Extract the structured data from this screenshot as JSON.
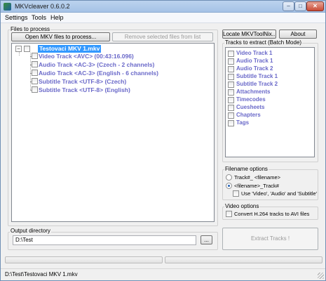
{
  "window": {
    "title": "MKVcleaver 0.6.0.2"
  },
  "titlebar": {
    "minimize": "–",
    "maximize": "□",
    "close": "✕"
  },
  "menu": [
    "Settings",
    "Tools",
    "Help"
  ],
  "files_group": {
    "label": "Files to process",
    "open_button": "Open MKV files to process...",
    "remove_button": "Remove selected files from list",
    "tree": {
      "root": "Testovaci MKV 1.mkv",
      "expander": "−",
      "tracks": [
        "Video Track <AVC> (00:43:16.096)",
        "Audio Track <AC-3> (Czech - 2 channels)",
        "Audio Track <AC-3> (English - 6 channels)",
        "Subtitle Track <UTF-8> (Czech)",
        "Subtitle Track <UTF-8> (English)"
      ]
    }
  },
  "top_right": {
    "locate_button": "Locate MKVToolNix...",
    "about_button": "About"
  },
  "batch_group": {
    "label": "Tracks to extract (Batch Mode)",
    "items": [
      "Video Track 1",
      "Audio Track 1",
      "Audio Track 2",
      "Subtitle Track 1",
      "Subtitle Track 2",
      "Attachments",
      "Timecodes",
      "Cuesheets",
      "Chapters",
      "Tags"
    ]
  },
  "filename_group": {
    "label": "Filename options",
    "option1": "Track#_ <filename>",
    "option2": "<filename>_Track#",
    "checkbox": "Use 'Video', 'Audio' and 'Subtitle'"
  },
  "video_group": {
    "label": "Video options",
    "checkbox": "Convert H.264 tracks to AVI files"
  },
  "output_group": {
    "label": "Output directory",
    "path": "D:\\Test",
    "browse_button": "..."
  },
  "extract_button": "Extract Tracks !",
  "status": {
    "text": "D:\\Test\\Testovaci MKV 1.mkv"
  }
}
